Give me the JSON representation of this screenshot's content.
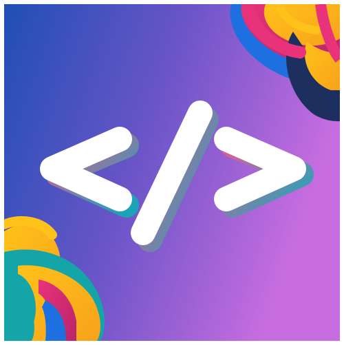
{
  "logo": {
    "icon_name": "code-brackets-icon",
    "glyph": "</>",
    "colors": {
      "gradient_start": "#1f4fb5",
      "gradient_mid": "#6b55c8",
      "gradient_end": "#c86de0",
      "symbol": "#ffffff",
      "shadow_teal": "#1aa7b8",
      "shadow_pink": "#e0608f",
      "ribbon_pink": "#e8337a",
      "ribbon_magenta": "#b8246b",
      "ribbon_orange": "#f7a21b",
      "ribbon_yellow": "#ffc21a",
      "ribbon_blue": "#1e6fe0",
      "ribbon_teal": "#15a4a8",
      "ribbon_navy": "#1d2f5e"
    }
  }
}
